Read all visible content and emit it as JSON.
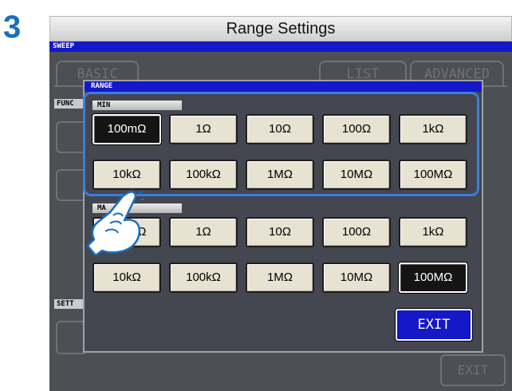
{
  "step": {
    "number": "3"
  },
  "window": {
    "title": "Range Settings"
  },
  "screen": {
    "mode_label": "SWEEP",
    "background_tabs": [
      "BASIC",
      "LIST",
      "ADVANCED"
    ],
    "background_labels": {
      "func": "FUNC",
      "sett": "SETT"
    },
    "background_buttons": {
      "exit": "EXIT"
    }
  },
  "dialog": {
    "title": "RANGE",
    "min": {
      "label": "MIN",
      "row1": [
        "100mΩ",
        "1Ω",
        "10Ω",
        "100Ω",
        "1kΩ"
      ],
      "row2": [
        "10kΩ",
        "100kΩ",
        "1MΩ",
        "10MΩ",
        "100MΩ"
      ],
      "selected": "100mΩ"
    },
    "max": {
      "label": "MA",
      "row1": [
        "100mΩ",
        "1Ω",
        "10Ω",
        "100Ω",
        "1kΩ"
      ],
      "row2": [
        "10kΩ",
        "100kΩ",
        "1MΩ",
        "10MΩ",
        "100MΩ"
      ],
      "selected": "100MΩ"
    },
    "exit_label": "EXIT"
  },
  "colors": {
    "accent": "#1418c8",
    "step": "#1a6fc0",
    "highlight": "#3a7ee0",
    "button": "#e8e2d2",
    "selected": "#141414"
  }
}
